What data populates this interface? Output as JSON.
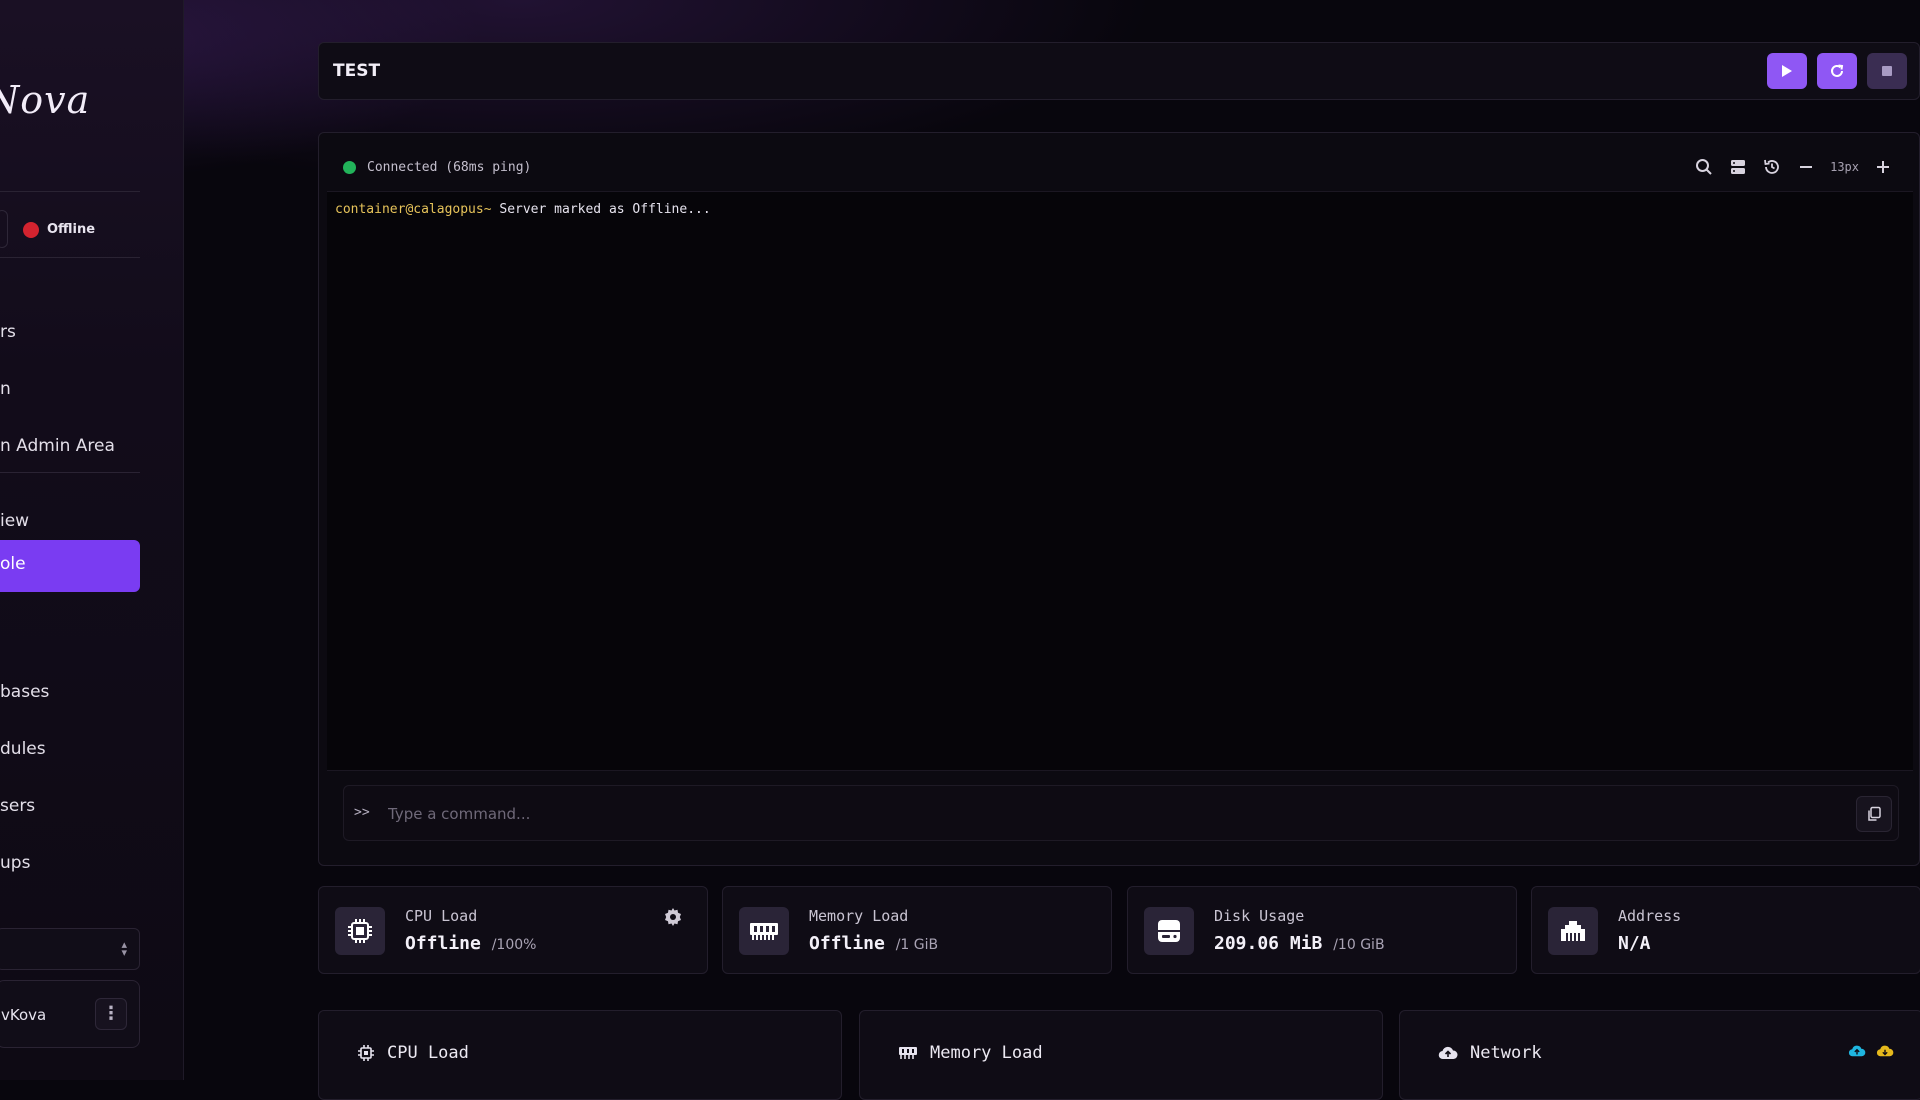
{
  "sidebar": {
    "logo": "Nova",
    "status": {
      "label": "Offline",
      "color": "#d3232f"
    },
    "nav": [
      {
        "label": "rs"
      },
      {
        "label": "n"
      },
      {
        "label": "n Admin Area"
      },
      {
        "label": "iew"
      },
      {
        "label": "ole",
        "active": true
      },
      {
        "label": "bases"
      },
      {
        "label": "dules"
      },
      {
        "label": "sers"
      },
      {
        "label": "ups"
      }
    ],
    "user": {
      "name": "vKova"
    }
  },
  "header": {
    "title": "TEST",
    "controls": {
      "start": "start-icon",
      "restart": "restart-icon",
      "stop": "stop-icon"
    }
  },
  "console": {
    "connection": "Connected (68ms ping)",
    "font_size": "13px",
    "lines": [
      {
        "prompt": "container@calagopus~",
        "message": "Server marked as Offline..."
      }
    ],
    "command": {
      "prefix": ">>",
      "placeholder": "Type a command...",
      "value": ""
    }
  },
  "stats": {
    "cpu": {
      "label": "CPU Load",
      "value": "Offline",
      "max": "/100%"
    },
    "memory": {
      "label": "Memory Load",
      "value": "Offline",
      "max": "/1 GiB"
    },
    "disk": {
      "label": "Disk Usage",
      "value": "209.06 MiB",
      "max": "/10 GiB"
    },
    "address": {
      "label": "Address",
      "value": "N/A"
    }
  },
  "graphs": {
    "cpu": {
      "title": "CPU Load"
    },
    "memory": {
      "title": "Memory Load"
    },
    "network": {
      "title": "Network",
      "upload_color": "#1fb6e0",
      "download_color": "#e6b91c"
    }
  },
  "colors": {
    "accent": "#8f57f4",
    "active_nav": "#7a3cf2",
    "connected": "#22b35a",
    "prompt": "#e6c35a"
  }
}
